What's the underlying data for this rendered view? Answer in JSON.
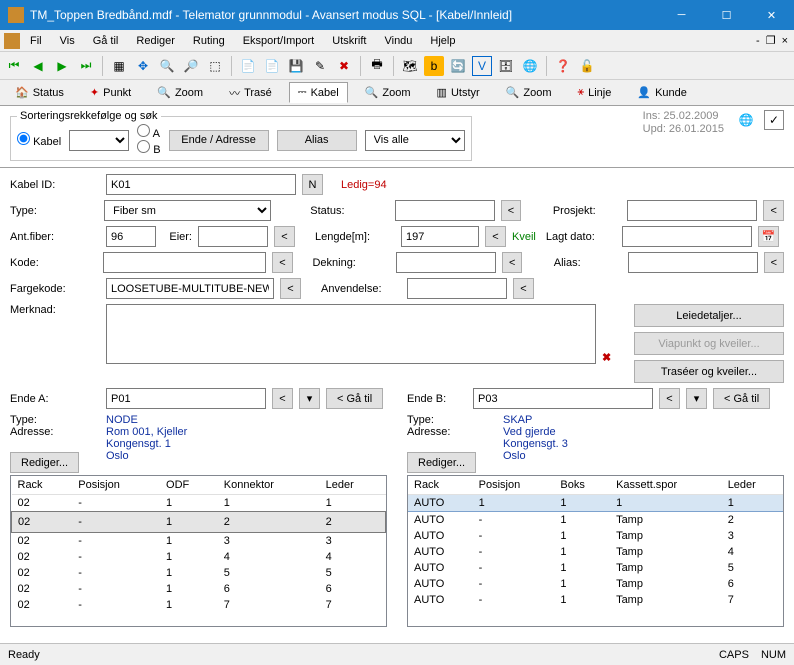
{
  "window": {
    "title": "TM_Toppen Bredbånd.mdf - Telemator grunnmodul - Avansert modus SQL - [Kabel/Innleid]"
  },
  "menu": {
    "items": [
      "Fil",
      "Vis",
      "Gå til",
      "Rediger",
      "Ruting",
      "Eksport/Import",
      "Utskrift",
      "Vindu",
      "Hjelp"
    ]
  },
  "tabs": {
    "items": [
      "Status",
      "Punkt",
      "Zoom",
      "Trasé",
      "Kabel",
      "Zoom",
      "Utstyr",
      "Zoom",
      "Linje",
      "Kunde"
    ],
    "active": 4
  },
  "sort": {
    "legend": "Sorteringsrekkefølge og søk",
    "radio_kabel": "Kabel",
    "radio_a": "A",
    "radio_b": "B",
    "btn_ende": "Ende / Adresse",
    "btn_alias": "Alias",
    "vis": "Vis alle"
  },
  "ts": {
    "ins": "Ins: 25.02.2009",
    "upd": "Upd: 26.01.2015"
  },
  "fields": {
    "kabel_id_lbl": "Kabel ID:",
    "kabel_id": "K01",
    "n": "N",
    "ledig": "Ledig=94",
    "type_lbl": "Type:",
    "type": "Fiber sm",
    "status_lbl": "Status:",
    "status": "",
    "prosjekt_lbl": "Prosjekt:",
    "prosjekt": "",
    "ant_lbl": "Ant.fiber:",
    "ant": "96",
    "eier_lbl": "Eier:",
    "eier": "",
    "lengde_lbl": "Lengde[m]:",
    "lengde": "197",
    "kveil": "Kveil",
    "lagt_lbl": "Lagt dato:",
    "lagt": "",
    "kode_lbl": "Kode:",
    "kode": "",
    "dekning_lbl": "Dekning:",
    "dekning": "",
    "alias_lbl": "Alias:",
    "alias": "",
    "farge_lbl": "Fargekode:",
    "farge": "LOOSETUBE-MULTITUBE-NEW",
    "anv_lbl": "Anvendelse:",
    "anv": "",
    "merknad_lbl": "Merknad:",
    "merknad": ""
  },
  "side_buttons": {
    "leie": "Leiedetaljer...",
    "via": "Viapunkt og kveiler...",
    "tras": "Traséer og kveiler..."
  },
  "endeA": {
    "lbl": "Ende A:",
    "id": "P01",
    "ga": "< Gå til",
    "type_lbl": "Type:",
    "type": "NODE",
    "adr_lbl": "Adresse:",
    "adr1": "Rom 001, Kjeller",
    "adr2": "Kongensgt. 1",
    "adr3": "Oslo",
    "rediger": "Rediger...",
    "headers": [
      "Rack",
      "Posisjon",
      "ODF",
      "Konnektor",
      "Leder"
    ],
    "rows": [
      [
        "02",
        "-",
        "1",
        "1",
        "1"
      ],
      [
        "02",
        "-",
        "1",
        "2",
        "2"
      ],
      [
        "02",
        "-",
        "1",
        "3",
        "3"
      ],
      [
        "02",
        "-",
        "1",
        "4",
        "4"
      ],
      [
        "02",
        "-",
        "1",
        "5",
        "5"
      ],
      [
        "02",
        "-",
        "1",
        "6",
        "6"
      ],
      [
        "02",
        "-",
        "1",
        "7",
        "7"
      ]
    ]
  },
  "endeB": {
    "lbl": "Ende B:",
    "id": "P03",
    "ga": "< Gå til",
    "type_lbl": "Type:",
    "type": "SKAP",
    "adr_lbl": "Adresse:",
    "adr1": "Ved gjerde",
    "adr2": "Kongensgt. 3",
    "adr3": "Oslo",
    "rediger": "Rediger...",
    "headers": [
      "Rack",
      "Posisjon",
      "Boks",
      "Kassett.spor",
      "Leder"
    ],
    "rows": [
      [
        "AUTO",
        "1",
        "1",
        "1",
        "1"
      ],
      [
        "AUTO",
        "-",
        "1",
        "Tamp",
        "2"
      ],
      [
        "AUTO",
        "-",
        "1",
        "Tamp",
        "3"
      ],
      [
        "AUTO",
        "-",
        "1",
        "Tamp",
        "4"
      ],
      [
        "AUTO",
        "-",
        "1",
        "Tamp",
        "5"
      ],
      [
        "AUTO",
        "-",
        "1",
        "Tamp",
        "6"
      ],
      [
        "AUTO",
        "-",
        "1",
        "Tamp",
        "7"
      ]
    ]
  },
  "status": {
    "ready": "Ready",
    "caps": "CAPS",
    "num": "NUM"
  }
}
